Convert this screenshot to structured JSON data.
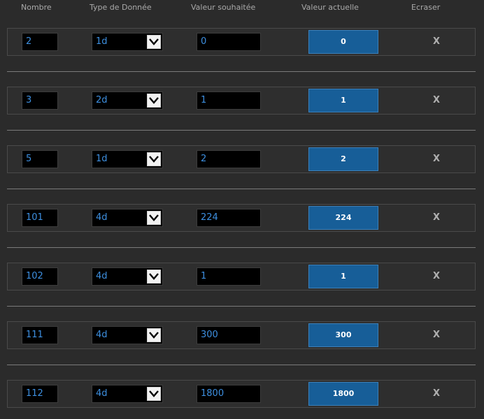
{
  "headers": {
    "nombre": "Nombre",
    "type": "Type de Donnée",
    "souhaitee": "Valeur souhaitée",
    "actuelle": "Valeur actuelle",
    "ecraser": "Ecraser"
  },
  "rows": [
    {
      "nombre": "2",
      "type": "1d",
      "souhaitee": "0",
      "actuelle": "0",
      "delete": "X"
    },
    {
      "nombre": "3",
      "type": "2d",
      "souhaitee": "1",
      "actuelle": "1",
      "delete": "X"
    },
    {
      "nombre": "5",
      "type": "1d",
      "souhaitee": "2",
      "actuelle": "2",
      "delete": "X"
    },
    {
      "nombre": "101",
      "type": "4d",
      "souhaitee": "224",
      "actuelle": "224",
      "delete": "X"
    },
    {
      "nombre": "102",
      "type": "4d",
      "souhaitee": "1",
      "actuelle": "1",
      "delete": "X"
    },
    {
      "nombre": "111",
      "type": "4d",
      "souhaitee": "300",
      "actuelle": "300",
      "delete": "X"
    },
    {
      "nombre": "112",
      "type": "4d",
      "souhaitee": "1800",
      "actuelle": "1800",
      "delete": "X"
    }
  ],
  "colors": {
    "background": "#2b2b2b",
    "field_text": "#3d8fe0",
    "actual_button": "#175e98",
    "separator": "#7a7a7a"
  },
  "icons": {
    "select_arrow": "chevron-down-icon",
    "delete": "close-icon"
  }
}
